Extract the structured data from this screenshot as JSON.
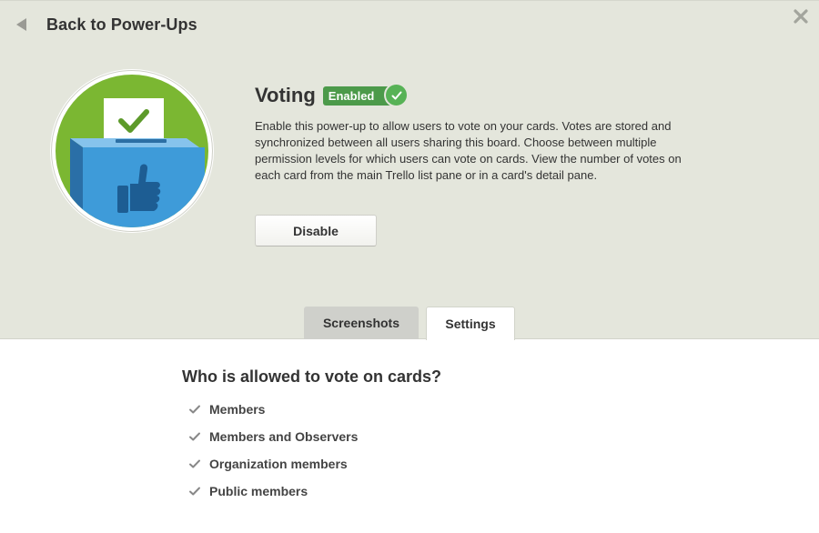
{
  "header": {
    "back_label": "Back to Power-Ups"
  },
  "powerup": {
    "title": "Voting",
    "badge": "Enabled",
    "description": "Enable this power-up to allow users to vote on your cards. Votes are stored and synchronized between all users sharing this board. Choose between multiple permission levels for which users can vote on cards. View the number of votes on each card from the main Trello list pane or in a card's detail pane.",
    "disable_label": "Disable"
  },
  "tabs": [
    {
      "label": "Screenshots"
    },
    {
      "label": "Settings"
    }
  ],
  "settings": {
    "question": "Who is allowed to vote on cards?",
    "options": [
      {
        "label": "Members"
      },
      {
        "label": "Members and Observers"
      },
      {
        "label": "Organization members"
      },
      {
        "label": "Public members"
      }
    ]
  },
  "colors": {
    "header_bg": "#e4e6dc",
    "enabled_green": "#4c9a4a",
    "check_green": "#57b256",
    "logo_green": "#7bb732",
    "box_blue": "#3e9bd9"
  },
  "icons": {
    "back": "back-arrow-icon",
    "close": "close-icon",
    "badge_check": "checkmark-icon",
    "option_check": "checkmark-icon",
    "logo": "ballot-box-thumbs-up-icon"
  }
}
